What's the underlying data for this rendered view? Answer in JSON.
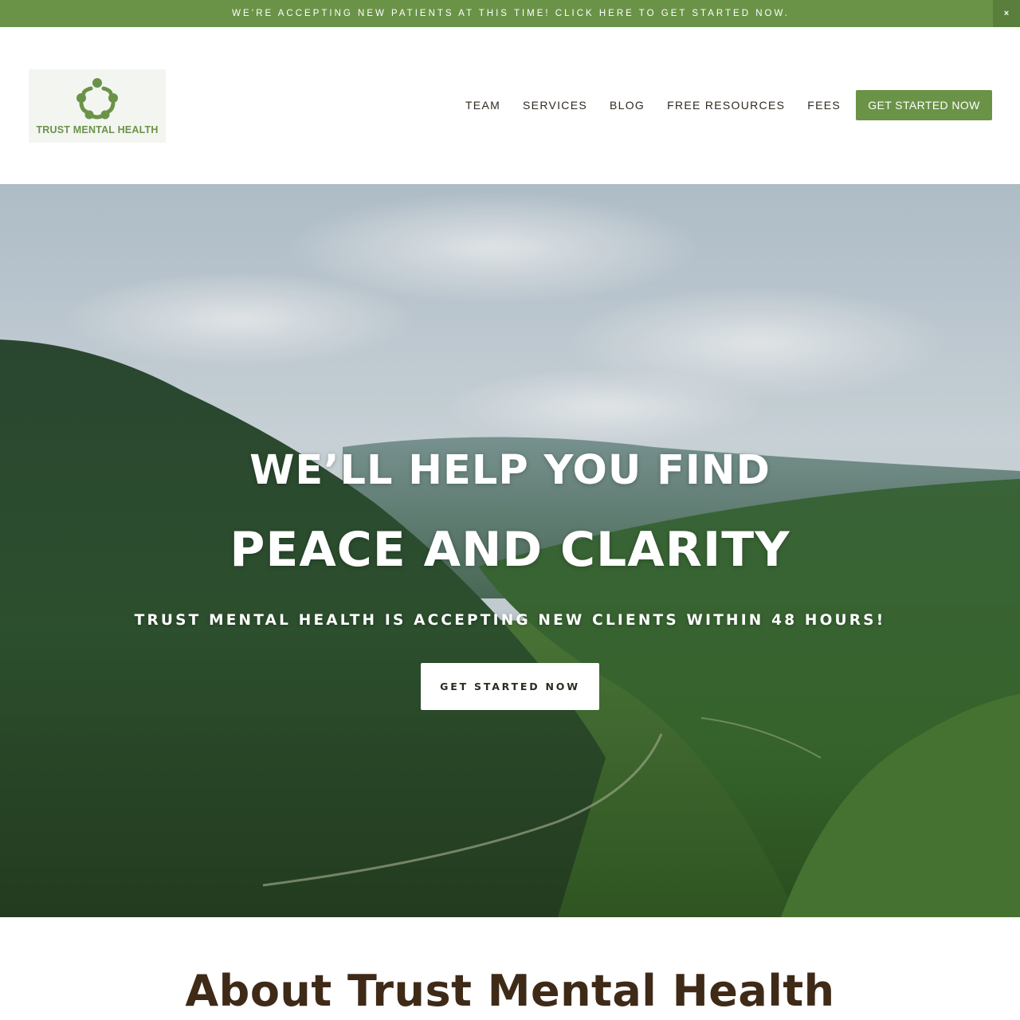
{
  "announcement": {
    "text": "We’re accepting new patients at this time! Click here to get started now.",
    "close_symbol": "×"
  },
  "header": {
    "logo_text": "TRUST MENTAL HEALTH",
    "nav": {
      "items": [
        "TEAM",
        "SERVICES",
        "BLOG",
        "FREE RESOURCES",
        "FEES"
      ],
      "cta_label": "GET STARTED NOW"
    }
  },
  "hero": {
    "line1": "WE’LL HELP YOU FIND",
    "line2": "PEACE AND CLARITY",
    "subtitle": "TRUST MENTAL HEALTH IS ACCEPTING NEW CLIENTS WITHIN 48 HOURS!",
    "button_label": "GET STARTED NOW",
    "background": "forested-valley-landscape"
  },
  "about": {
    "title": "About Trust Mental Health"
  },
  "colors": {
    "brand_green": "#6a9347",
    "dark_brown": "#3e2a17",
    "nav_text": "#2f2a1f"
  }
}
